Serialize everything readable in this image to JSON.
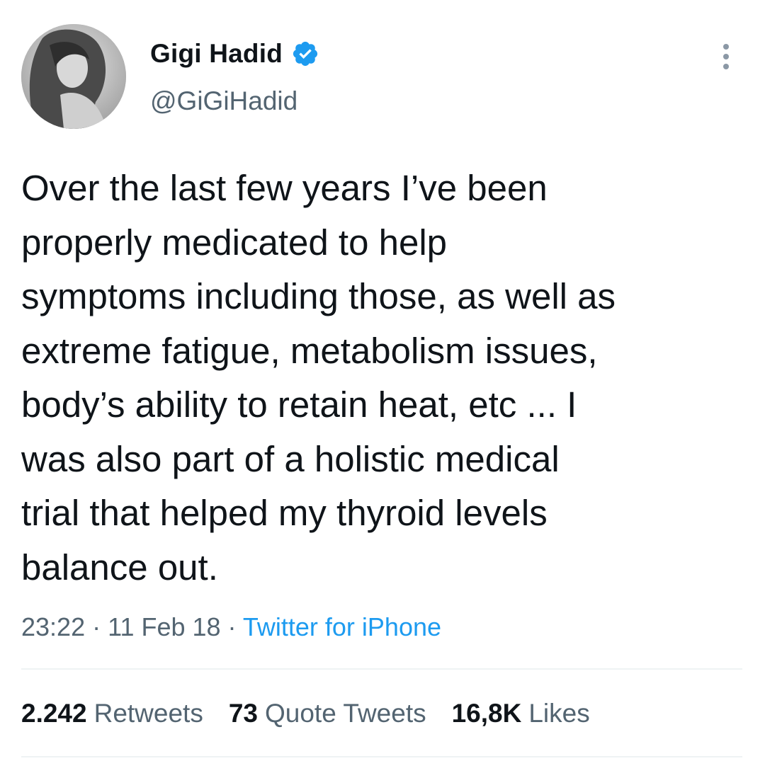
{
  "author": {
    "display_name": "Gigi Hadid",
    "handle": "@GiGiHadid",
    "verified_icon": "verified-badge-icon",
    "avatar": "profile-photo"
  },
  "tweet": {
    "text": "Over the last few years I’ve been\nproperly medicated to help\nsymptoms including those, as well as\nextreme fatigue, metabolism issues,\nbody’s ability to retain heat, etc ... I\nwas also part of a holistic medical\ntrial that helped my thyroid levels\nbalance out."
  },
  "meta": {
    "time": "23:22",
    "sep1": " · ",
    "date": "11 Feb 18",
    "sep2": " · ",
    "source": "Twitter for iPhone"
  },
  "stats": {
    "retweets": {
      "count": "2.242",
      "label": "Retweets"
    },
    "quotes": {
      "count": "73",
      "label": "Quote Tweets"
    },
    "likes": {
      "count": "16,8K",
      "label": "Likes"
    }
  },
  "icons": {
    "more": "more-options-icon"
  },
  "colors": {
    "text": "#0f1419",
    "secondary": "#536471",
    "accent": "#1d9bf0",
    "divider": "#eff3f4"
  }
}
